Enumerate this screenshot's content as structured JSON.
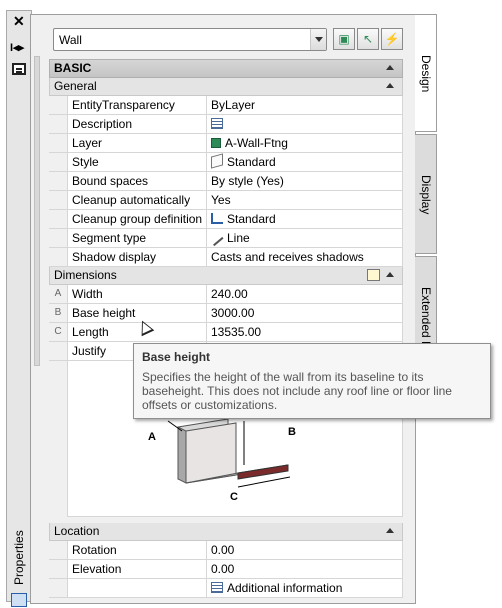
{
  "palette": {
    "title": "Properties"
  },
  "header": {
    "object_type": "Wall"
  },
  "tabs": [
    {
      "label": "Design"
    },
    {
      "label": "Display"
    },
    {
      "label": "Extended Data"
    }
  ],
  "basic": {
    "category": "BASIC",
    "general": {
      "title": "General",
      "rows": [
        {
          "name": "EntityTransparency",
          "value": "ByLayer",
          "icon": ""
        },
        {
          "name": "Description",
          "value": "",
          "icon": "description-icon"
        },
        {
          "name": "Layer",
          "value": "A-Wall-Ftng",
          "icon": "layer-color-icon"
        },
        {
          "name": "Style",
          "value": "Standard",
          "icon": "wall-style-icon"
        },
        {
          "name": "Bound spaces",
          "value": "By style (Yes)",
          "icon": ""
        },
        {
          "name": "Cleanup automatically",
          "value": "Yes",
          "icon": ""
        },
        {
          "name": "Cleanup group definition",
          "value": "Standard",
          "icon": "cleanup-group-icon"
        },
        {
          "name": "Segment type",
          "value": "Line",
          "icon": "segment-line-icon"
        },
        {
          "name": "Shadow display",
          "value": "Casts and receives shadows",
          "icon": ""
        }
      ]
    },
    "dimensions": {
      "title": "Dimensions",
      "rows": [
        {
          "key": "A",
          "name": "Width",
          "value": "240.00"
        },
        {
          "key": "B",
          "name": "Base height",
          "value": "3000.00"
        },
        {
          "key": "C",
          "name": "Length",
          "value": "13535.00"
        },
        {
          "key": "",
          "name": "Justify",
          "value": ""
        }
      ],
      "diagram_labels": [
        "A",
        "B",
        "C"
      ]
    },
    "location": {
      "title": "Location",
      "rows": [
        {
          "name": "Rotation",
          "value": "0.00"
        },
        {
          "name": "Elevation",
          "value": "0.00"
        },
        {
          "name": "",
          "value": "Additional information"
        }
      ]
    }
  },
  "tooltip": {
    "title": "Base height",
    "body": "Specifies the height of the wall from its baseline to its baseheight. This does not include any roof line or floor line offsets or customizations."
  }
}
